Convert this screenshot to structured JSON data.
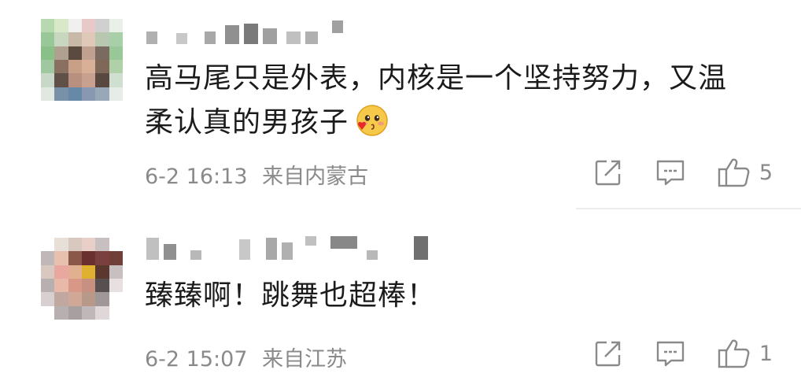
{
  "comments": [
    {
      "text_line1": "高马尾只是外表，内核是一个坚持努力，又温",
      "text_line2": "柔认真的男孩子",
      "emoji": "smiling-face-blowing-kiss-emoji",
      "date": "6-2 16:13",
      "location": "来自内蒙古",
      "likes": "5"
    },
    {
      "text": "臻臻啊！跳舞也超棒！",
      "date": "6-2 15:07",
      "location": "来自江苏",
      "likes": "1"
    }
  ],
  "icons": {
    "share": "share-icon",
    "reply": "comment-icon",
    "like": "thumbs-up-icon"
  },
  "colors": {
    "text": "#1b1b1b",
    "meta": "#8a8a8a",
    "divider": "#ececec"
  }
}
